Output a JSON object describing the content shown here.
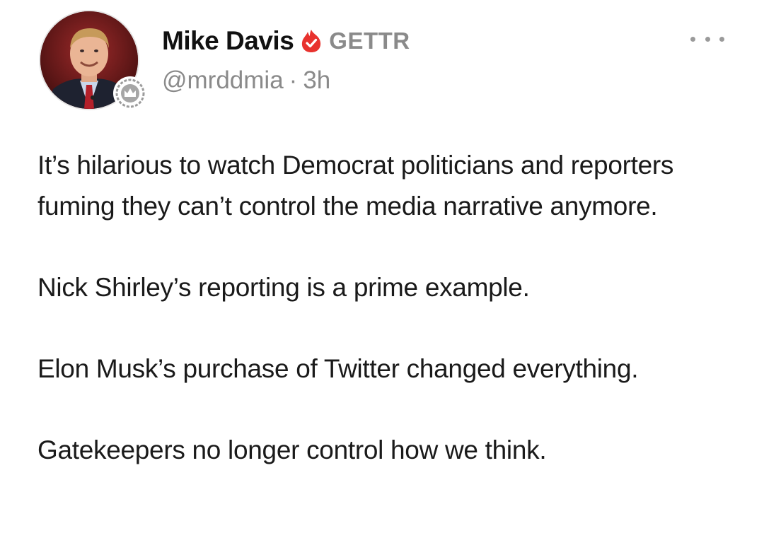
{
  "post": {
    "author": {
      "display_name": "Mike Davis",
      "verified_icon": "verified-flame-check-icon",
      "platform": "GETTR",
      "handle": "@mrddmia",
      "separator": "·",
      "time_ago": "3h",
      "avatar_icon": "profile-photo",
      "badge_icon": "crown-badge-icon"
    },
    "menu_icon": "more-options-icon",
    "body": {
      "line1": "It’s hilarious to watch Democrat politicians and reporters fuming they can’t control the media narrative anymore.",
      "line2": "Nick Shirley’s reporting is a prime example.",
      "line3": "Elon Musk’s purchase of Twitter changed everything.",
      "line4": "Gatekeepers no longer control how we think."
    }
  },
  "colors": {
    "accent_red": "#e8322e",
    "secondary_text": "#8a8a8a",
    "primary_text": "#1a1a1a"
  }
}
